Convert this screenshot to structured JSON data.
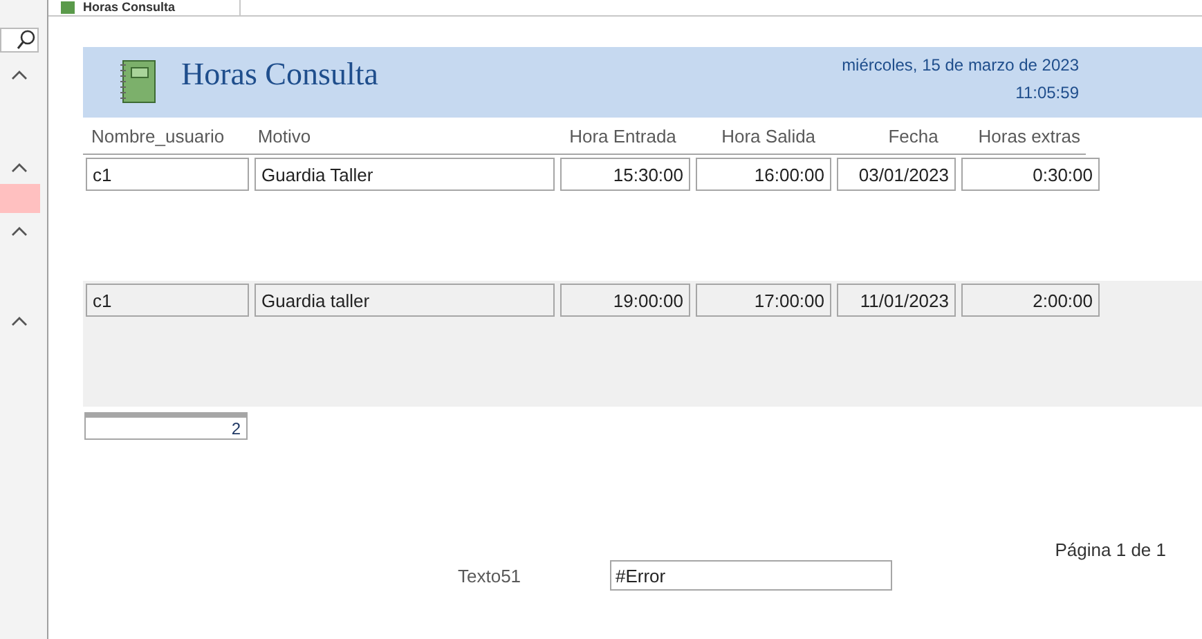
{
  "tab": {
    "title": "Horas Consulta"
  },
  "report": {
    "title": "Horas Consulta",
    "date": "miércoles, 15 de marzo de 2023",
    "time": "11:05:59",
    "columns": [
      {
        "label": "Nombre_usuario"
      },
      {
        "label": "Motivo"
      },
      {
        "label": "Hora Entrada"
      },
      {
        "label": "Hora Salida"
      },
      {
        "label": "Fecha"
      },
      {
        "label": "Horas extras"
      }
    ],
    "rows": [
      {
        "shaded": false,
        "values": [
          "c1",
          "Guardia Taller",
          "15:30:00",
          "16:00:00",
          "03/01/2023",
          "0:30:00"
        ]
      },
      {
        "shaded": true,
        "values": [
          "c1",
          "Guardia taller",
          "19:00:00",
          "17:00:00",
          "11/01/2023",
          "2:00:00"
        ]
      }
    ],
    "count": "2",
    "page": "Página 1 de 1",
    "field": {
      "label": "Texto51",
      "value": "#Error"
    }
  }
}
